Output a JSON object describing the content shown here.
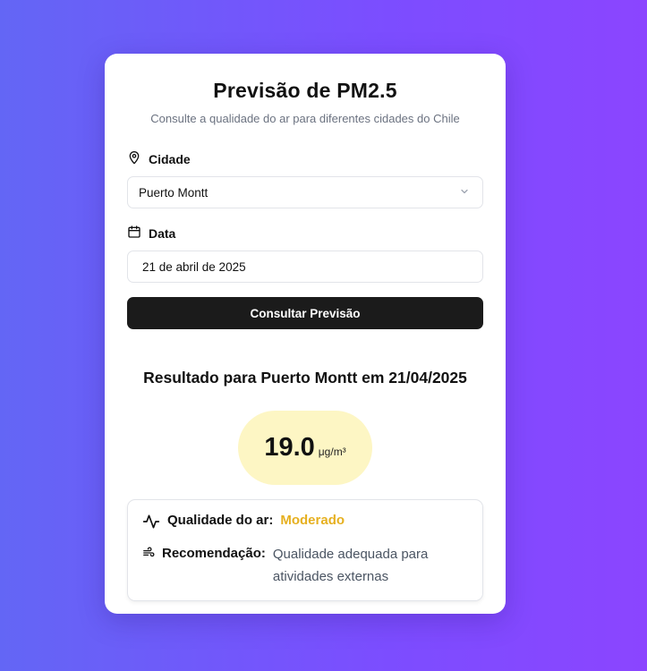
{
  "header": {
    "title": "Previsão de PM2.5",
    "subtitle": "Consulte a qualidade do ar para diferentes cidades do Chile"
  },
  "form": {
    "city_label": "Cidade",
    "city_value": "Puerto Montt",
    "date_label": "Data",
    "date_value": "21 de abril de 2025",
    "submit_label": "Consultar Previsão"
  },
  "result": {
    "title": "Resultado para Puerto Montt em 21/04/2025",
    "pm_value": "19.0",
    "pm_unit": "μg/m³",
    "quality_label": "Qualidade do ar:",
    "quality_value": "Moderado",
    "recommendation_label": "Recomendação:",
    "recommendation_text": "Qualidade adequada para atividades externas"
  },
  "icons": {
    "city": "map-pin-icon",
    "date": "calendar-icon",
    "select": "chevron-down-icon",
    "quality": "activity-icon",
    "recommendation": "wind-icon"
  },
  "colors": {
    "background_start": "#6366f5",
    "background_end": "#8b45ff",
    "button": "#1b1b1b",
    "badge": "#fdf6c4",
    "moderate": "#e6b020"
  }
}
